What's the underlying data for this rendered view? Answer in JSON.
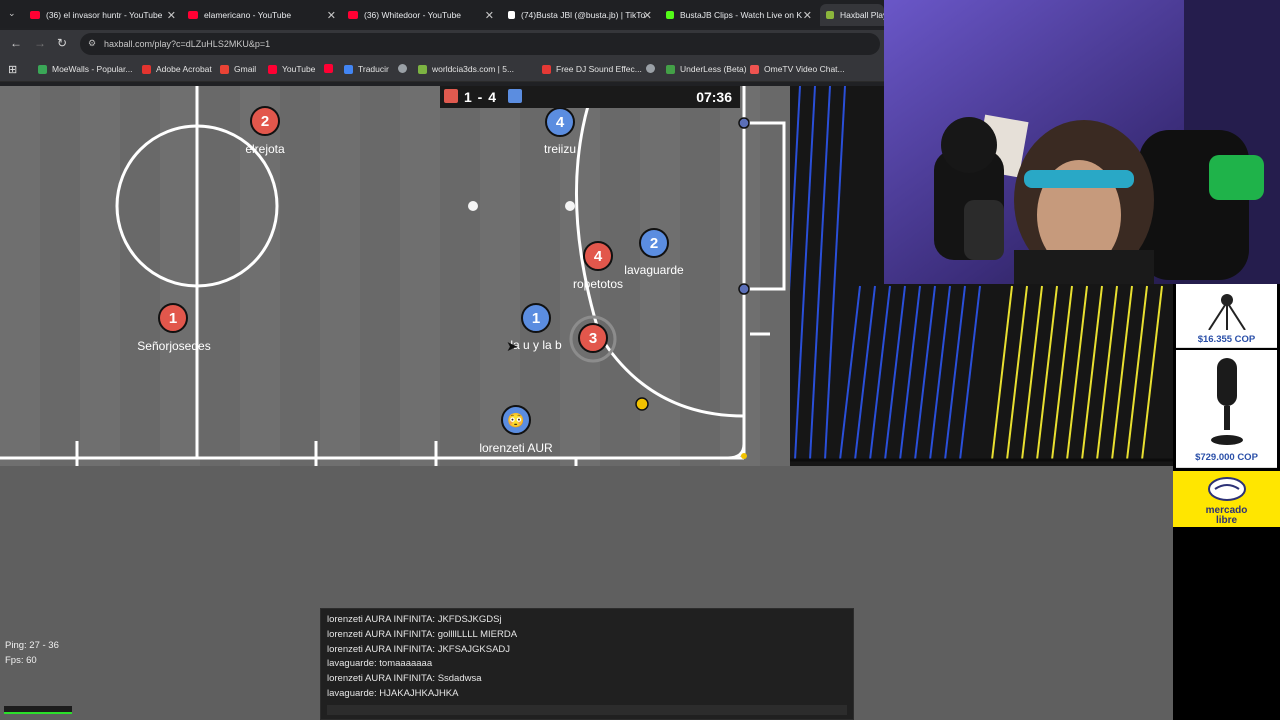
{
  "browser": {
    "tabs": [
      {
        "title": "(36) el invasor huntr - YouTube",
        "icon": "youtube-icon",
        "color": "#ff0033"
      },
      {
        "title": "elamericano - YouTube",
        "icon": "youtube-icon",
        "color": "#ff0033"
      },
      {
        "title": "(36) Whitedoor - YouTube",
        "icon": "youtube-icon",
        "color": "#ff0033"
      },
      {
        "title": "(74)Busta JBl (@busta.jb) | TikTo",
        "icon": "tiktok-icon",
        "color": "#ffffff"
      },
      {
        "title": "BustaJB Clips - Watch Live on K",
        "icon": "kick-icon",
        "color": "#53fc18"
      },
      {
        "title": "Haxball Play",
        "icon": "haxball-icon",
        "color": "#8cb63c"
      }
    ],
    "url": "haxball.com/play?c=dLZuHLS2MKU&p=1",
    "bookmarks": [
      {
        "label": "MoeWalls - Popular...",
        "color": "#3aa757"
      },
      {
        "label": "Adobe Acrobat",
        "color": "#e3342f"
      },
      {
        "label": "Gmail",
        "color": "#ea4335"
      },
      {
        "label": "YouTube",
        "color": "#ff0033"
      },
      {
        "label": "",
        "color": "#ff0033"
      },
      {
        "label": "Traducir",
        "color": "#4285f4"
      },
      {
        "label": "",
        "color": "#9aa0a6"
      },
      {
        "label": "worldcia3ds.com | 5...",
        "color": "#7cb342"
      },
      {
        "label": "Free DJ Sound Effec...",
        "color": "#e53935"
      },
      {
        "label": "",
        "color": "#9aa0a6"
      },
      {
        "label": "UnderLess (Beta)",
        "color": "#43a047"
      },
      {
        "label": "OmeTV Video Chat...",
        "color": "#ef5350"
      }
    ]
  },
  "game": {
    "score_red": "1",
    "score_blue": "4",
    "score_text": "1 - 4",
    "time": "07:36",
    "colors": {
      "red": "#e2574c",
      "blue": "#5b8de0",
      "ball": "#f2c200"
    },
    "players": [
      {
        "team": "red",
        "number": "2",
        "name": "elrejota"
      },
      {
        "team": "blue",
        "number": "4",
        "name": "treiizu"
      },
      {
        "team": "red",
        "number": "4",
        "name": "ropetotos"
      },
      {
        "team": "blue",
        "number": "2",
        "name": "lavaguarde"
      },
      {
        "team": "red",
        "number": "1",
        "name": "Señorjosedes"
      },
      {
        "team": "blue",
        "number": "1",
        "name": "la u y la b"
      },
      {
        "team": "red",
        "number": "3",
        "name": ""
      },
      {
        "team": "blue",
        "number": "😳",
        "name": "lorenzeti AUR"
      }
    ],
    "stats": {
      "ping": "Ping: 27 - 36",
      "fps": "Fps: 60"
    },
    "chat": [
      "lorenzeti AURA INFINITA: JKFDSJKGDSj",
      "lorenzeti AURA INFINITA: gollllLLLL MIERDA",
      "lorenzeti AURA INFINITA: JKFSAJGKSADJ",
      "lavaguarde: tomaaaaaaa",
      "lorenzeti AURA INFINITA: Ssdadwsa",
      "lavaguarde: HJAKAJHKAJHKA"
    ]
  },
  "shop": {
    "items": [
      {
        "price": "$16.355 COP",
        "icon": "tripod-icon"
      },
      {
        "price": "$729.000 COP",
        "icon": "microphone-icon"
      }
    ],
    "brand": "mercado libre"
  }
}
